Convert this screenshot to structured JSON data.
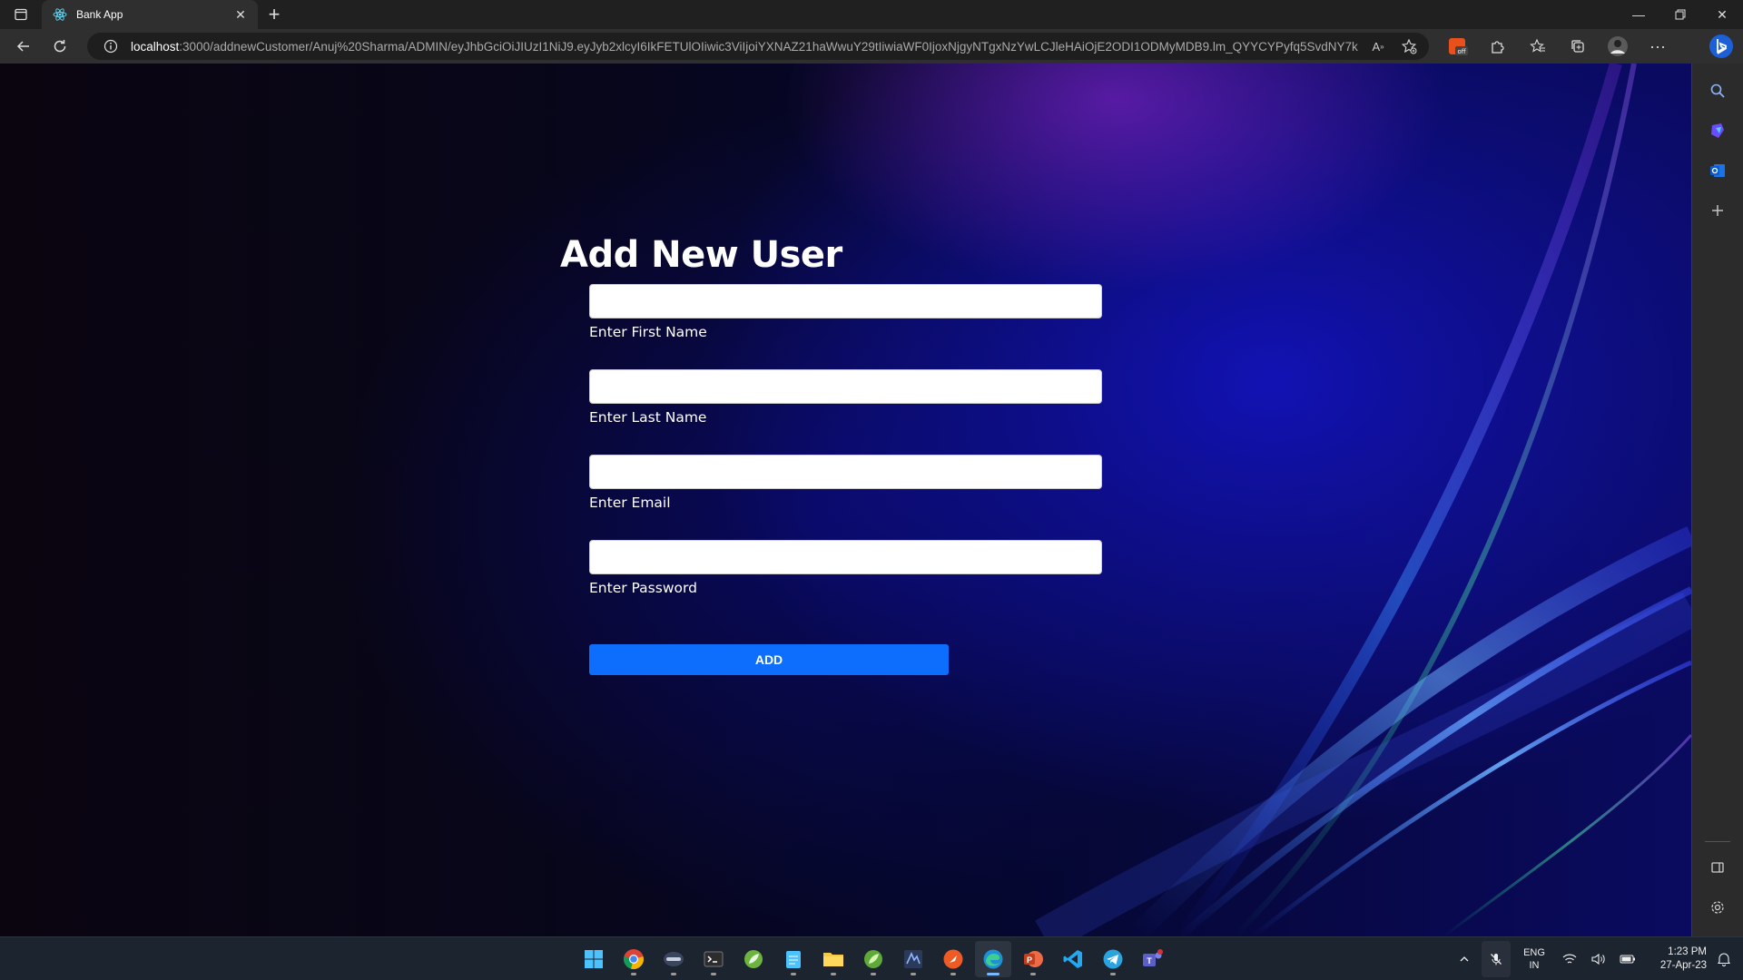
{
  "browser": {
    "tab": {
      "title": "Bank App"
    },
    "url_host": "localhost",
    "url_rest": ":3000/addnewCustomer/Anuj%20Sharma/ADMIN/eyJhbGciOiJIUzI1NiJ9.eyJyb2xlcyI6IkFETUlOIiwic3ViIjoiYXNAZ21haWwuY29tIiwiaWF0IjoxNjgyNTgxNzYwLCJleHAiOjE2ODI1ODMyMDB9.lm_QYYCYPyfq5SvdNY7k...",
    "ext_badge": "off"
  },
  "page": {
    "title": "Add New User",
    "fields": [
      {
        "label": "Enter First Name",
        "value": "",
        "placeholder": ""
      },
      {
        "label": "Enter Last Name",
        "value": "",
        "placeholder": ""
      },
      {
        "label": "Enter Email",
        "value": "",
        "placeholder": ""
      },
      {
        "label": "Enter Password",
        "value": "",
        "placeholder": ""
      }
    ],
    "add_button": "ADD"
  },
  "taskbar": {
    "apps": [
      "windows-start",
      "chrome",
      "remote-desktop",
      "terminal",
      "spring-tool-suite",
      "notepad",
      "file-explorer",
      "spring-boot",
      "sts-ide",
      "postman",
      "edge",
      "powerpoint",
      "vscode",
      "telegram",
      "teams"
    ],
    "language_line1": "ENG",
    "language_line2": "IN",
    "time": "1:23 PM",
    "date": "27-Apr-23"
  },
  "colors": {
    "accent": "#0d6efd",
    "background_dark": "#07061a",
    "background_blue": "#1414c8"
  }
}
